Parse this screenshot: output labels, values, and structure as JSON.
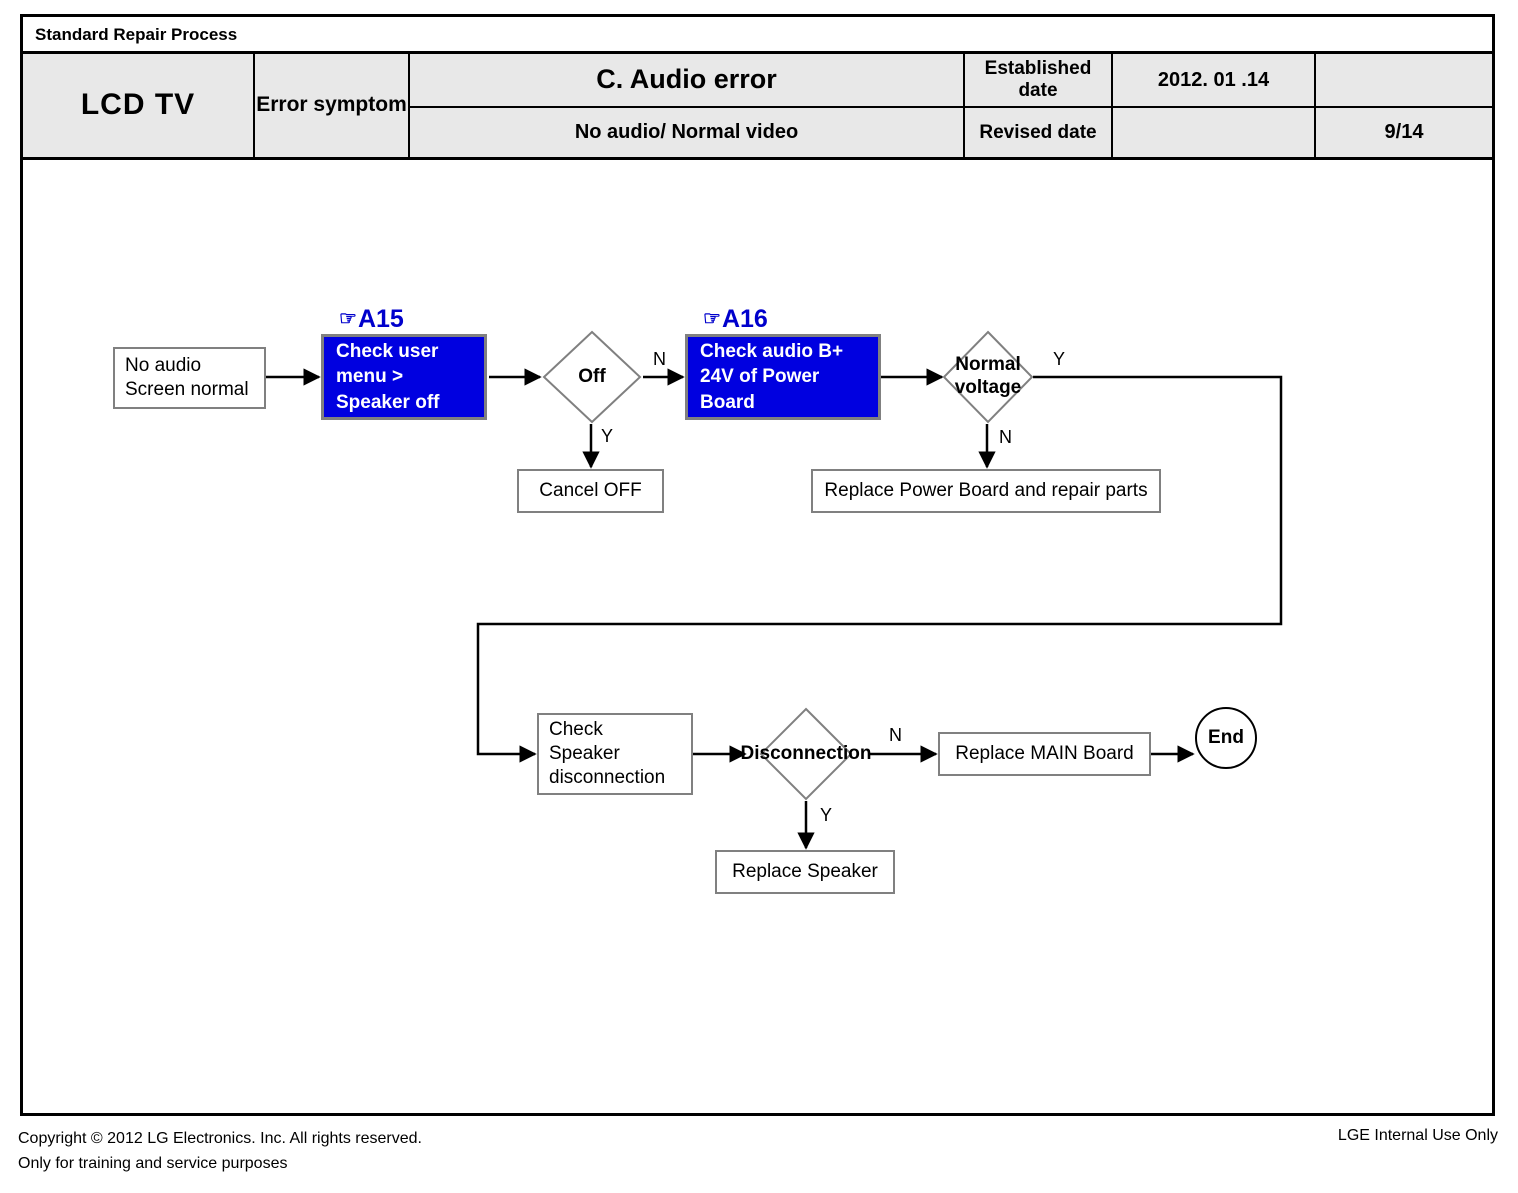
{
  "sheet": {
    "title_strip": "Standard Repair Process",
    "header": {
      "model": "LCD  TV",
      "error_symptom_label": "Error symptom",
      "error_title": "C. Audio error",
      "error_subtitle": "No audio/ Normal video",
      "established_date_label": "Established date",
      "established_date_value": "2012. 01 .14",
      "revised_date_label": "Revised date",
      "revised_date_value": "",
      "top_right_value": "",
      "page_number": "9/14"
    }
  },
  "colors": {
    "highlight_blue": "#0000E0",
    "tag_blue": "#0000CC",
    "node_border_gray": "#808080",
    "header_fill": "#e8e8e8",
    "line_black": "#000000"
  },
  "flowchart": {
    "type": "flowchart",
    "tags": [
      {
        "id": "tag-a15",
        "hand": "☞",
        "label": "A15"
      },
      {
        "id": "tag-a16",
        "hand": "☞",
        "label": "A16"
      }
    ],
    "nodes": [
      {
        "id": "start",
        "shape": "box",
        "text": "No audio\nScreen normal"
      },
      {
        "id": "check-user-menu",
        "shape": "box-blue",
        "text": "Check user\nmenu  >\nSpeaker off"
      },
      {
        "id": "off",
        "shape": "diamond",
        "text": "Off"
      },
      {
        "id": "cancel-off",
        "shape": "box",
        "text": "Cancel OFF"
      },
      {
        "id": "check-audio-bplus",
        "shape": "box-blue",
        "text": "Check audio B+\n24V of Power\nBoard"
      },
      {
        "id": "normal-voltage",
        "shape": "diamond",
        "text": "Normal\nvoltage"
      },
      {
        "id": "replace-power-board",
        "shape": "box",
        "text": "Replace Power Board and repair parts"
      },
      {
        "id": "check-speaker",
        "shape": "box",
        "text": "Check\nSpeaker\ndisconnection"
      },
      {
        "id": "disconnection",
        "shape": "diamond",
        "text": "Disconnection"
      },
      {
        "id": "replace-speaker",
        "shape": "box",
        "text": "Replace Speaker"
      },
      {
        "id": "replace-main-board",
        "shape": "box",
        "text": "Replace MAIN Board"
      },
      {
        "id": "end",
        "shape": "circle",
        "text": "End"
      }
    ],
    "branch_labels": {
      "off_no": "N",
      "off_yes": "Y",
      "normal_voltage_yes": "Y",
      "normal_voltage_no": "N",
      "disconnection_no": "N",
      "disconnection_yes": "Y"
    }
  },
  "footer": {
    "copyright": "Copyright © 2012 LG Electronics. Inc. All rights reserved.\nOnly for training and service purposes",
    "notice": "LGE Internal Use Only"
  }
}
